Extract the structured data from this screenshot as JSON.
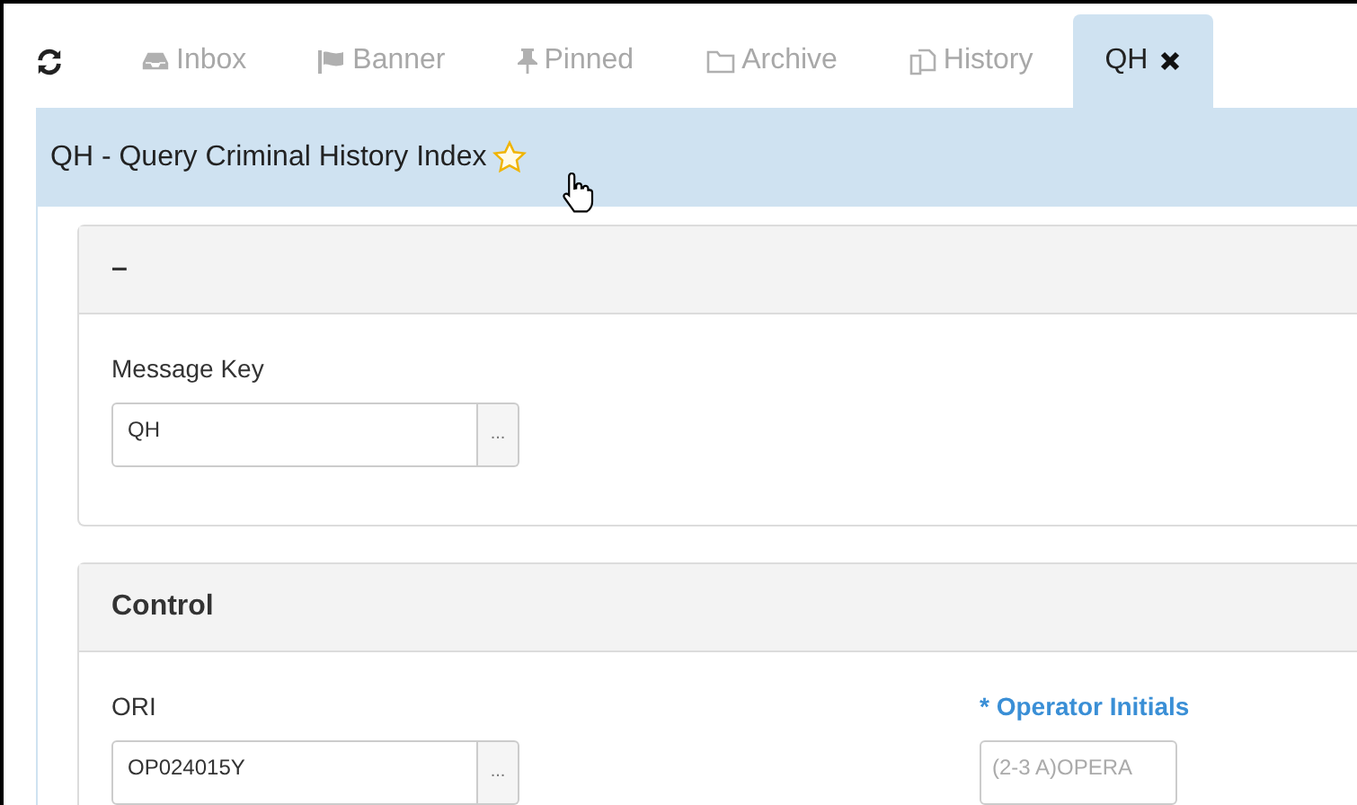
{
  "tabs": [
    {
      "label": "Inbox",
      "kind": "inbox",
      "selected": false
    },
    {
      "label": "Banner",
      "kind": "flag",
      "selected": false
    },
    {
      "label": "Pinned",
      "kind": "pin",
      "selected": false
    },
    {
      "label": "Archive",
      "kind": "folder",
      "selected": false
    },
    {
      "label": "History",
      "kind": "copy",
      "selected": false
    },
    {
      "label": "QH",
      "kind": "closable",
      "selected": true
    }
  ],
  "title": {
    "text": "QH - Query Criminal History Index",
    "favorite": false
  },
  "sections": [
    {
      "heading": "–",
      "fields": [
        {
          "label": "Message Key",
          "value": "QH",
          "required": false,
          "lookup_label": "..."
        }
      ]
    },
    {
      "heading": "Control",
      "fields": [
        {
          "label": "ORI",
          "value": "OP024015Y",
          "required": false,
          "lookup_label": "..."
        },
        {
          "label": "* Operator Initials",
          "placeholder": "(2-3 A)OPERA",
          "required": true
        }
      ]
    }
  ]
}
